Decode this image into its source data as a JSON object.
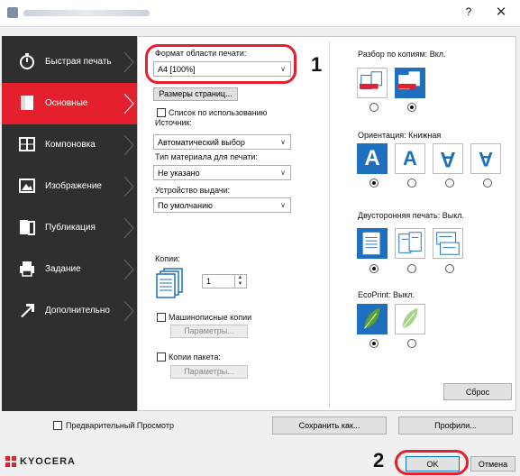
{
  "window": {
    "help": "?",
    "close": "✕"
  },
  "sidebar": {
    "items": [
      {
        "label": "Быстрая печать",
        "icon": "stopwatch-icon"
      },
      {
        "label": "Основные",
        "icon": "document-icon"
      },
      {
        "label": "Компоновка",
        "icon": "layout-grid-icon"
      },
      {
        "label": "Изображение",
        "icon": "image-icon"
      },
      {
        "label": "Публикация",
        "icon": "publication-icon"
      },
      {
        "label": "Задание",
        "icon": "printer-job-icon"
      },
      {
        "label": "Дополнительно",
        "icon": "arrow-advanced-icon"
      }
    ]
  },
  "basic": {
    "print_size_label": "Формат области печати:",
    "print_size_value": "A4 [100%]",
    "page_sizes_button": "Размеры страниц...",
    "size_list_label": "Список по использованию",
    "source_label": "Источник:",
    "source_value": "Автоматический выбор",
    "media_label": "Тип материала для печати:",
    "media_value": "Не указано",
    "output_label": "Устройство выдачи:",
    "output_value": "По умолчанию",
    "copies_label": "Копии:",
    "copies_value": "1",
    "typist_label": "Машинописные копии",
    "typist_params": "Параметры...",
    "batch_label": "Копии пакета:",
    "batch_params": "Параметры...",
    "reset_button": "Сброс"
  },
  "right": {
    "collate_label": "Разбор по копиям:",
    "collate_value": "Вкл.",
    "orientation_label": "Ориентация:",
    "orientation_value": "Книжная",
    "duplex_label": "Двусторонняя печать:",
    "duplex_value": "Выкл.",
    "ecoprint_label": "EcoPrint:",
    "ecoprint_value": "Выкл."
  },
  "bottom": {
    "preview_label": "Предварительный Просмотр",
    "save_as": "Сохранить как...",
    "profiles": "Профили..."
  },
  "footer": {
    "brand": "KYOCERA",
    "ok": "OK",
    "cancel": "Отмена"
  },
  "annotations": {
    "one": "1",
    "two": "2"
  },
  "colors": {
    "accent": "#e4202f",
    "sidebar": "#2f2f2f",
    "selected_tile": "#1f6fbf"
  }
}
